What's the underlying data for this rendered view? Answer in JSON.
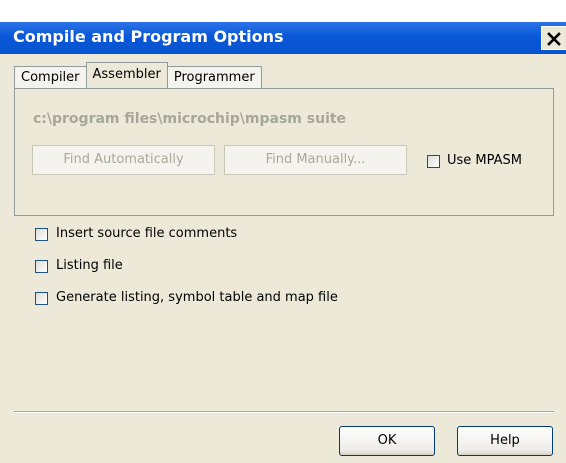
{
  "top_fragment": "‾ ‾ ′ ′  ′",
  "window": {
    "title": "Compile and Program Options",
    "close_icon": "close-icon"
  },
  "tabs": [
    {
      "label": "Compiler",
      "active": false
    },
    {
      "label": "Assembler",
      "active": true
    },
    {
      "label": "Programmer",
      "active": false
    }
  ],
  "assembler": {
    "path": "c:\\program files\\microchip\\mpasm suite",
    "find_automatically_label": "Find Automatically",
    "find_manually_label": "Find Manually...",
    "use_mpasm_label": "Use MPASM",
    "use_mpasm_checked": false
  },
  "options": [
    {
      "label": "Insert source file comments",
      "checked": false
    },
    {
      "label": "Listing file",
      "checked": false
    },
    {
      "label": "Generate listing, symbol table and map file",
      "checked": false
    }
  ],
  "buttons": {
    "ok_label": "OK",
    "help_label": "Help"
  }
}
